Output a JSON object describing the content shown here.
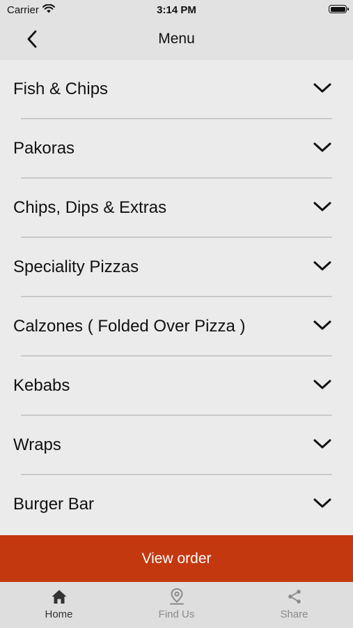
{
  "status_bar": {
    "carrier": "Carrier",
    "time": "3:14 PM"
  },
  "nav": {
    "title": "Menu",
    "back_icon": "chevron-left-icon"
  },
  "menu": {
    "items": [
      {
        "label": "Fish & Chips"
      },
      {
        "label": "Pakoras"
      },
      {
        "label": "Chips, Dips & Extras"
      },
      {
        "label": "Speciality Pizzas"
      },
      {
        "label": "Calzones ( Folded Over Pizza )"
      },
      {
        "label": "Kebabs"
      },
      {
        "label": "Wraps"
      },
      {
        "label": "Burger Bar"
      }
    ],
    "expand_icon": "chevron-down-icon"
  },
  "view_order": {
    "label": "View order",
    "color": "#c4380f"
  },
  "tabs": [
    {
      "label": "Home",
      "icon": "home-icon",
      "active": true
    },
    {
      "label": "Find Us",
      "icon": "location-pin-icon",
      "active": false
    },
    {
      "label": "Share",
      "icon": "share-icon",
      "active": false
    }
  ]
}
